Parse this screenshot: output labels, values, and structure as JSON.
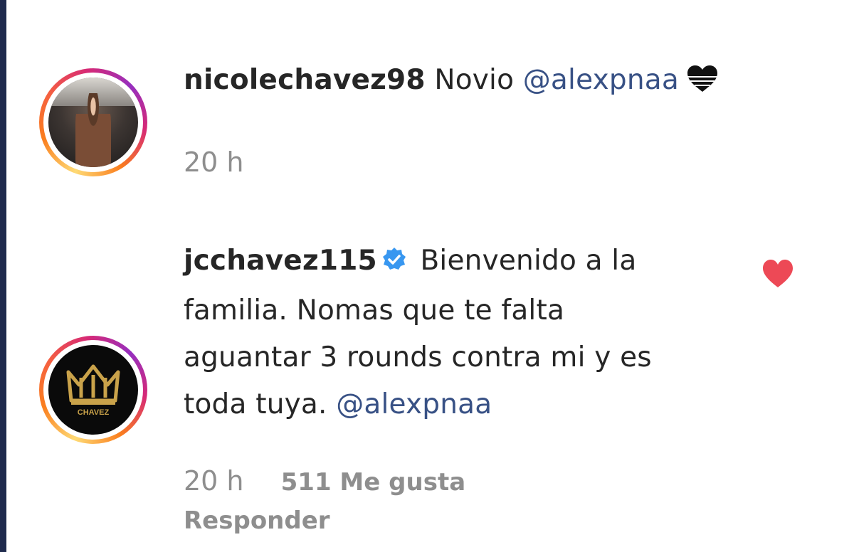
{
  "comments": [
    {
      "username": "nicolechavez98",
      "text": " Novio ",
      "mention": "@alexpnaa",
      "emoji": "black-heart",
      "time": "20 h"
    },
    {
      "username": "jcchavez115",
      "verified": true,
      "text_line1": " Bienvenido a la",
      "text_line2": "familia. Nomas que te falta",
      "text_line3": "aguantar 3 rounds contra mi y es",
      "text_line4": "toda tuya. ",
      "mention": "@alexpnaa",
      "time": "20 h",
      "likes": "511 Me gusta",
      "reply": "Responder",
      "liked": true,
      "logo_text": "CHAVEZ"
    }
  ],
  "colors": {
    "mention": "#385185",
    "meta": "#8e8e8e",
    "like_heart": "#ed4956",
    "verified": "#3897f0",
    "logo_gold": "#c9a24a"
  }
}
